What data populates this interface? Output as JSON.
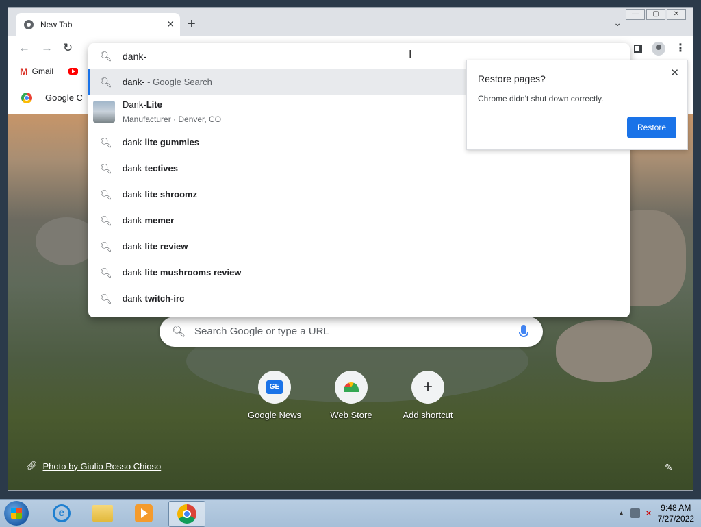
{
  "tab": {
    "title": "New Tab",
    "close": "✕"
  },
  "new_tab": "+",
  "tab_list": "⌄",
  "window_controls": [
    "—",
    "▢",
    "✕"
  ],
  "toolbar": {
    "back": "←",
    "forward": "→",
    "reload": "↻",
    "menu": "⋮"
  },
  "bookmarks": [
    {
      "label": "Gmail",
      "icon": "gmail-icon"
    },
    {
      "label": "",
      "icon": "youtube-icon"
    }
  ],
  "google_bar": {
    "label": "Google C"
  },
  "omnibox": {
    "value": "dank-",
    "suggestions": [
      {
        "prefix": "dank-",
        "suffix": " - Google Search",
        "selected": true
      },
      {
        "prefix": "dank-",
        "suffix": "lite gummies"
      },
      {
        "prefix": "dank-",
        "suffix": "tectives"
      },
      {
        "prefix": "dank-",
        "suffix": "lite shroomz"
      },
      {
        "prefix": "dank-",
        "suffix": "memer"
      },
      {
        "prefix": "dank-",
        "suffix": "lite review"
      },
      {
        "prefix": "dank-",
        "suffix": "lite mushrooms review"
      },
      {
        "prefix": "dank-",
        "suffix": "twitch-irc"
      }
    ],
    "entity": {
      "name_prefix": "Dank-",
      "name_suffix": "Lite",
      "description": "Manufacturer · Denver, CO"
    }
  },
  "restore": {
    "title": "Restore pages?",
    "description": "Chrome didn't shut down correctly.",
    "button": "Restore",
    "close": "✕"
  },
  "ntp": {
    "search_placeholder": "Search Google or type a URL",
    "shortcuts": [
      {
        "label": "Google News",
        "icon": "google-news-icon",
        "glyph": "GE"
      },
      {
        "label": "Web Store",
        "icon": "web-store-icon"
      },
      {
        "label": "Add shortcut",
        "icon": "plus-icon",
        "glyph": "+"
      }
    ],
    "credit": "Photo by Giulio Rosso Chioso",
    "edit": "✎"
  },
  "taskbar": {
    "time": "9:48 AM",
    "date": "7/27/2022",
    "tray_up": "▲",
    "volume": "✕"
  },
  "colors": {
    "accent": "#1a73e8",
    "omnibox_selected": "#e8eaed"
  }
}
